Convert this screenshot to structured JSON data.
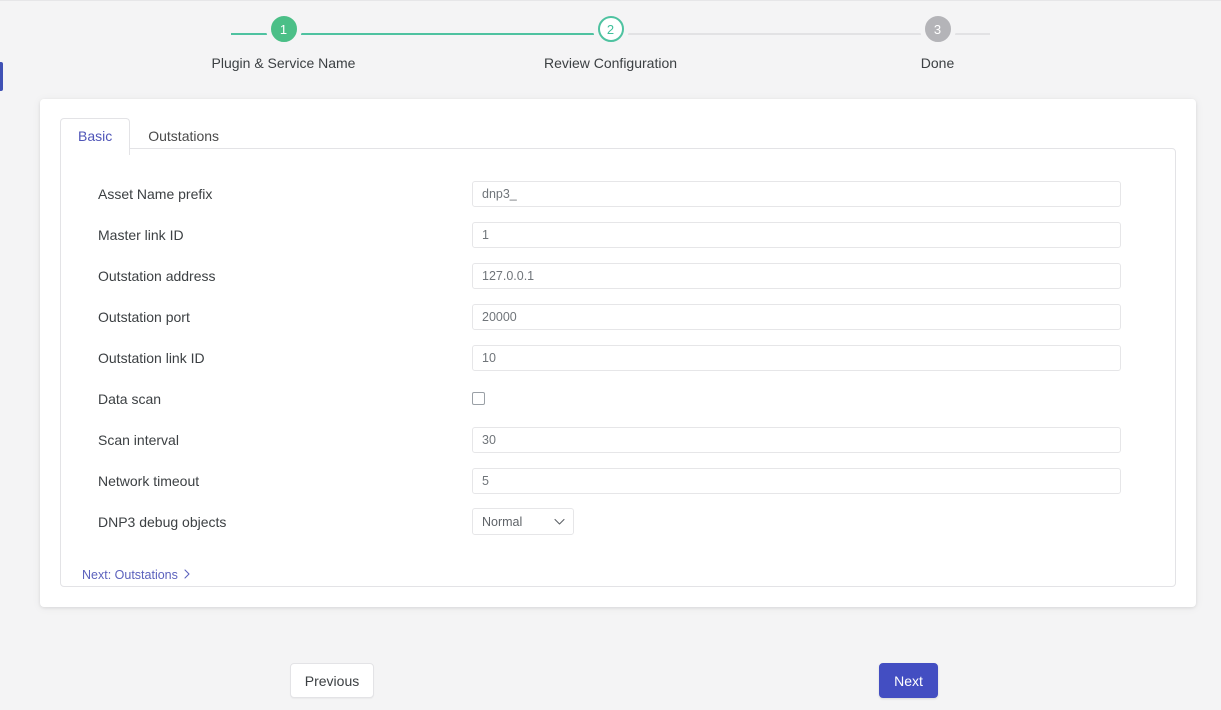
{
  "stepper": {
    "steps": [
      {
        "number": "1",
        "label": "Plugin & Service Name",
        "state": "complete"
      },
      {
        "number": "2",
        "label": "Review Configuration",
        "state": "current"
      },
      {
        "number": "3",
        "label": "Done",
        "state": "upcoming"
      }
    ],
    "colors": {
      "complete": "#4bbf87",
      "current": "#4ec2a0",
      "upcoming": "#b4b4b8",
      "track_done": "#4ec2a0",
      "track_todo": "#e2e2e4"
    }
  },
  "card": {
    "tabs": [
      {
        "label": "Basic",
        "active": true
      },
      {
        "label": "Outstations",
        "active": false
      }
    ],
    "fields": [
      {
        "label": "Asset Name prefix",
        "type": "text",
        "value": "dnp3_"
      },
      {
        "label": "Master link ID",
        "type": "text",
        "value": "1"
      },
      {
        "label": "Outstation address",
        "type": "text",
        "value": "127.0.0.1"
      },
      {
        "label": "Outstation port",
        "type": "text",
        "value": "20000"
      },
      {
        "label": "Outstation link ID",
        "type": "text",
        "value": "10"
      },
      {
        "label": "Data scan",
        "type": "checkbox",
        "value": ""
      },
      {
        "label": "Scan interval",
        "type": "text",
        "value": "30"
      },
      {
        "label": "Network timeout",
        "type": "text",
        "value": "5"
      },
      {
        "label": "DNP3 debug objects",
        "type": "select",
        "value": "Normal"
      }
    ],
    "next_link": "Next: Outstations",
    "next_link_chevron": "›"
  },
  "footer": {
    "previous_label": "Previous",
    "next_label": "Next",
    "next_color": "#434ec2"
  },
  "accent": {
    "left_bar_color": "#3f51b5"
  }
}
